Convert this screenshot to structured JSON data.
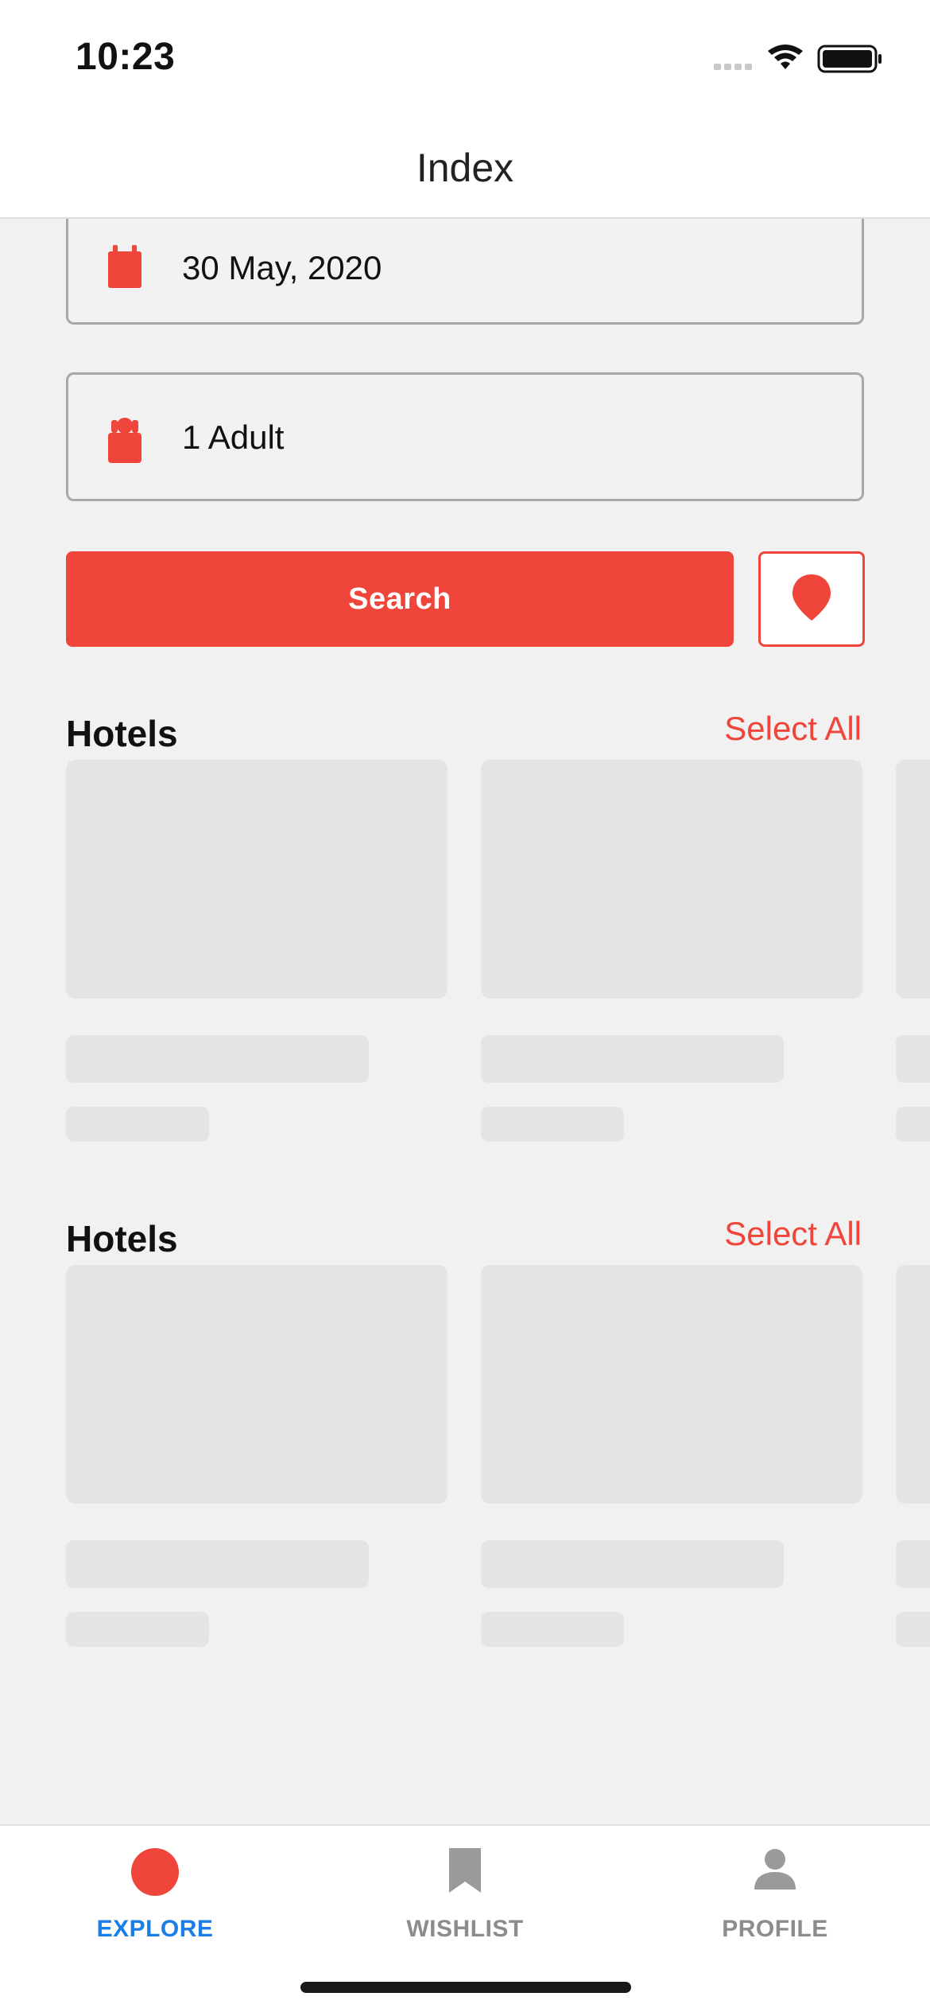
{
  "status_bar": {
    "time": "10:23"
  },
  "nav": {
    "title": "Index"
  },
  "form": {
    "date_value": "30 May, 2020",
    "date_icon": "calendar-icon",
    "guests_value": "1 Adult",
    "guests_icon": "person-icon",
    "search_label": "Search",
    "map_icon": "map-pin-icon"
  },
  "sections": [
    {
      "title": "Hotels",
      "action_label": "Select All"
    },
    {
      "title": "Hotels",
      "action_label": "Select All"
    }
  ],
  "tabs": [
    {
      "label": "EXPLORE",
      "icon": "explore-icon",
      "active": true
    },
    {
      "label": "WISHLIST",
      "icon": "bookmark-icon",
      "active": false
    },
    {
      "label": "PROFILE",
      "icon": "profile-icon",
      "active": false
    }
  ],
  "colors": {
    "accent": "#ef453b",
    "active_tab": "#1a7ee6",
    "inactive_tab": "#8c8c8c",
    "placeholder": "#e6e3e3"
  }
}
